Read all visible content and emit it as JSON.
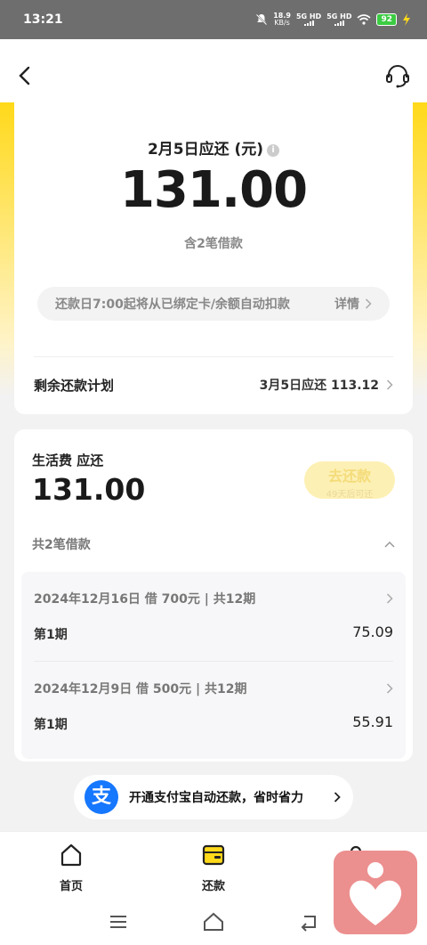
{
  "status_bar": {
    "time": "13:21",
    "speed": "18.9",
    "speed_unit": "KB/s",
    "sim1": "5G HD",
    "sim2": "5G HD",
    "battery": "92"
  },
  "header": {
    "back_icon": "chevron-left-icon",
    "service_icon": "headset-icon"
  },
  "summary": {
    "due_title": "2月5日应还 (元)",
    "due_amount": "131.00",
    "loan_count": "含2笔借款",
    "autopay_tip": "还款日7:00起将从已绑定卡/余额自动扣款",
    "autopay_detail": "详情",
    "plan_label": "剩余还款计划",
    "plan_value": "3月5日应还 113.12"
  },
  "living": {
    "title": "生活费 应还",
    "amount": "131.00",
    "repay_button": "去还款",
    "repay_sub": "49天后可还",
    "loans_header": "共2笔借款",
    "loans": [
      {
        "head": "2024年12月16日 借 700元 | 共12期",
        "period": "第1期",
        "amount": "75.09"
      },
      {
        "head": "2024年12月9日 借 500元 | 共12期",
        "period": "第1期",
        "amount": "55.91"
      }
    ]
  },
  "alipay_banner": {
    "icon_text": "支",
    "text": "开通支付宝自动还款，省时省力"
  },
  "bottom_nav": {
    "home": "首页",
    "repay": "还款"
  },
  "colors": {
    "accent_yellow": "#ffd91a",
    "alipay_blue": "#1677ff",
    "battery_green": "#3ccb43"
  }
}
